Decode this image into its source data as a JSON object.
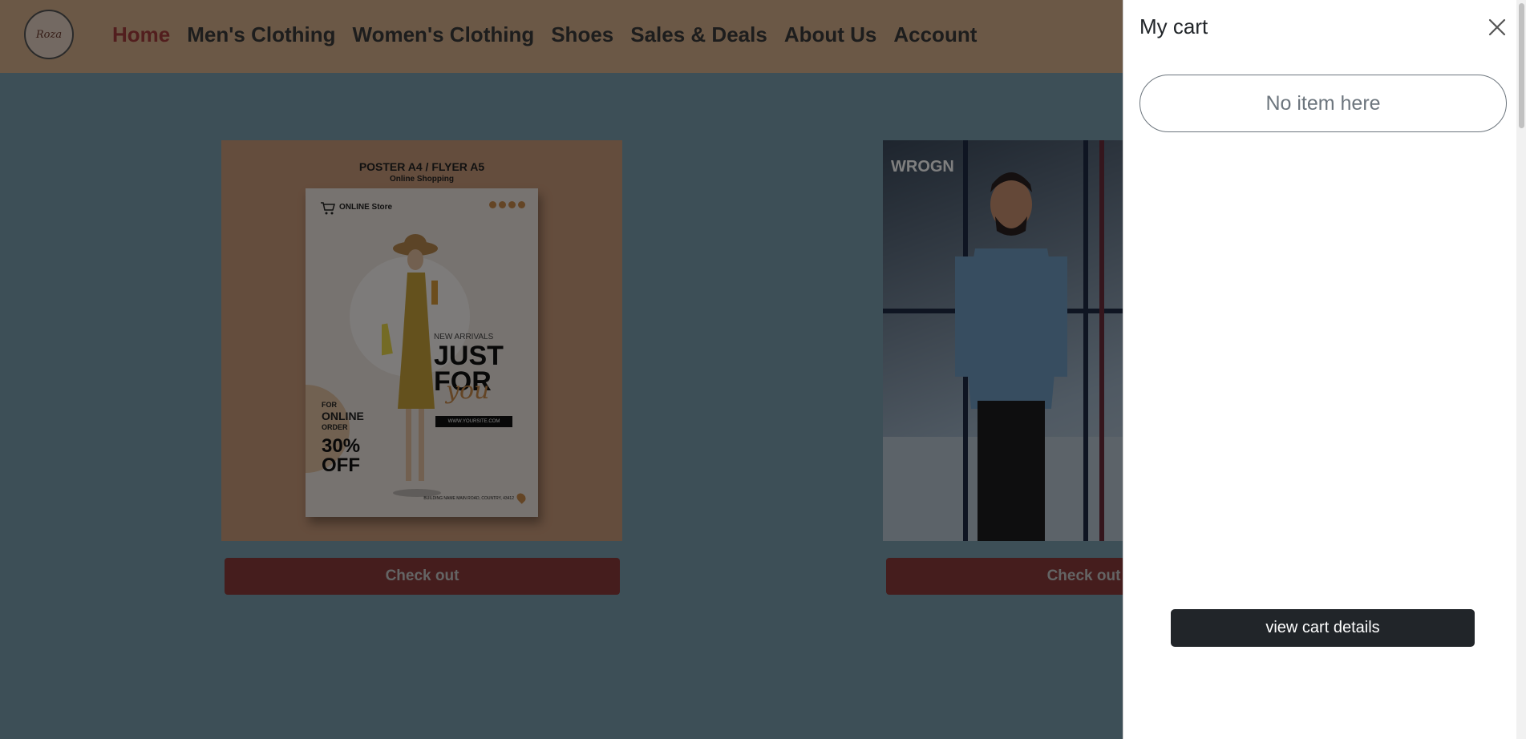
{
  "header": {
    "logo_text": "Roza",
    "nav": [
      {
        "label": "Home",
        "active": true
      },
      {
        "label": "Men's Clothing"
      },
      {
        "label": "Women's Clothing"
      },
      {
        "label": "Shoes"
      },
      {
        "label": "Sales & Deals"
      },
      {
        "label": "About Us"
      },
      {
        "label": "Account"
      }
    ]
  },
  "cards": [
    {
      "poster_title": "POSTER A4 / FLYER A5",
      "poster_subtitle": "Online Shopping",
      "store_text": "ONLINE Store",
      "new_arrivals": "NEW ARRIVALS",
      "headline": "JUST FOR",
      "script_text": "you",
      "url_text": "WWW.YOURSITE.COM",
      "promo_for": "FOR",
      "promo_online": "ONLINE",
      "promo_order": "ORDER",
      "promo_discount": "30% OFF",
      "address": "BUILDING NAME MAIN ROAD, COUNTRY, 43412",
      "button_label": "Check out"
    },
    {
      "brand": "WROGN",
      "button_label": "Check out"
    }
  ],
  "cart": {
    "title": "My cart",
    "empty_text": "No item here",
    "view_button": "view cart details"
  },
  "colors": {
    "header_bg": "#d6b08c",
    "page_bg": "#7b9fae",
    "active_nav": "#a53d3d",
    "checkout_button": "#8a3a3a",
    "cart_button": "#212529"
  },
  "icons": [
    "cart-icon",
    "close-icon"
  ]
}
